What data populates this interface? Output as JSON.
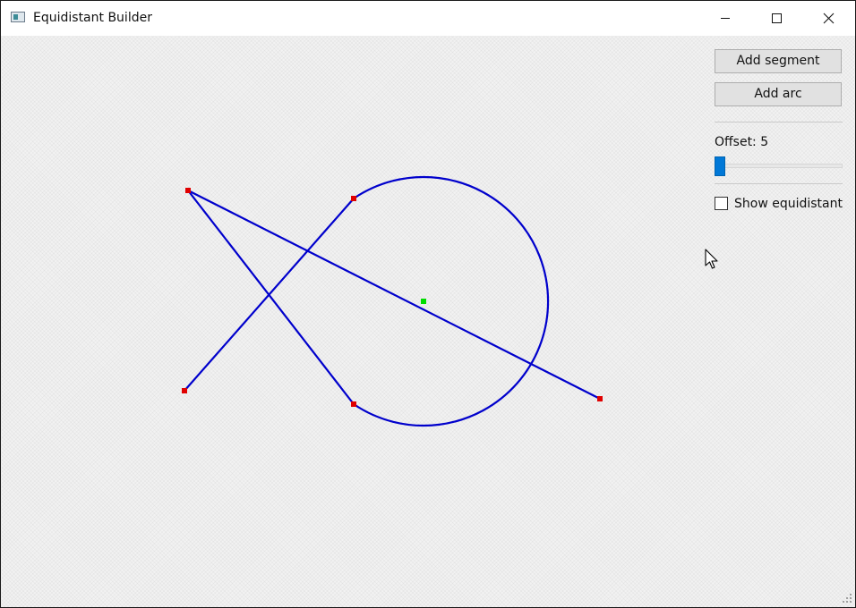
{
  "window": {
    "title": "Equidistant Builder"
  },
  "titlebar_buttons": {
    "minimize_icon": "minimize-icon",
    "maximize_icon": "maximize-icon",
    "close_icon": "close-icon"
  },
  "controls": {
    "add_segment_label": "Add segment",
    "add_arc_label": "Add arc",
    "offset_label": "Offset: 5",
    "offset_slider_fraction": 0.05,
    "show_equidistant_label": "Show equidistant",
    "show_equidistant_checked": false
  },
  "colors": {
    "geometry_stroke": "#0000cc",
    "endpoint_marker": "#e00000",
    "center_marker": "#00dd00",
    "accent": "#0078d7"
  }
}
